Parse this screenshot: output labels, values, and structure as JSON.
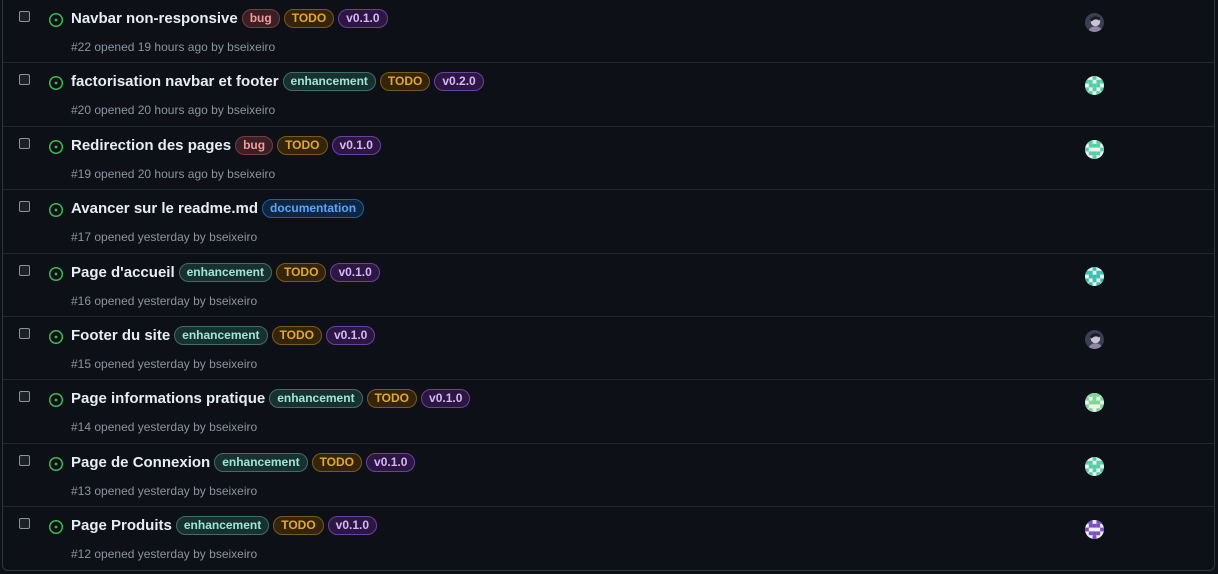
{
  "issues": [
    {
      "title": "Navbar non-responsive",
      "number": "#22",
      "opened": "opened 19 hours ago by",
      "author": "bseixeiro",
      "labels": [
        {
          "text": "bug",
          "kind": "bug"
        },
        {
          "text": "TODO",
          "kind": "todo"
        },
        {
          "text": "v0.1.0",
          "kind": "version"
        }
      ],
      "avatar": "photo"
    },
    {
      "title": "factorisation navbar et footer",
      "number": "#20",
      "opened": "opened 20 hours ago by",
      "author": "bseixeiro",
      "labels": [
        {
          "text": "enhancement",
          "kind": "enhancement"
        },
        {
          "text": "TODO",
          "kind": "todo"
        },
        {
          "text": "v0.2.0",
          "kind": "version"
        }
      ],
      "avatar": "mint"
    },
    {
      "title": "Redirection des pages",
      "number": "#19",
      "opened": "opened 20 hours ago by",
      "author": "bseixeiro",
      "labels": [
        {
          "text": "bug",
          "kind": "bug"
        },
        {
          "text": "TODO",
          "kind": "todo"
        },
        {
          "text": "v0.1.0",
          "kind": "version"
        }
      ],
      "avatar": "mint"
    },
    {
      "title": "Avancer sur le readme.md",
      "number": "#17",
      "opened": "opened yesterday by",
      "author": "bseixeiro",
      "labels": [
        {
          "text": "documentation",
          "kind": "documentation"
        }
      ],
      "avatar": ""
    },
    {
      "title": "Page d'accueil",
      "number": "#16",
      "opened": "opened yesterday by",
      "author": "bseixeiro",
      "labels": [
        {
          "text": "enhancement",
          "kind": "enhancement"
        },
        {
          "text": "TODO",
          "kind": "todo"
        },
        {
          "text": "v0.1.0",
          "kind": "version"
        }
      ],
      "avatar": "teal"
    },
    {
      "title": "Footer du site",
      "number": "#15",
      "opened": "opened yesterday by",
      "author": "bseixeiro",
      "labels": [
        {
          "text": "enhancement",
          "kind": "enhancement"
        },
        {
          "text": "TODO",
          "kind": "todo"
        },
        {
          "text": "v0.1.0",
          "kind": "version"
        }
      ],
      "avatar": "photo"
    },
    {
      "title": "Page informations pratique",
      "number": "#14",
      "opened": "opened yesterday by",
      "author": "bseixeiro",
      "labels": [
        {
          "text": "enhancement",
          "kind": "enhancement"
        },
        {
          "text": "TODO",
          "kind": "todo"
        },
        {
          "text": "v0.1.0",
          "kind": "version"
        }
      ],
      "avatar": "green"
    },
    {
      "title": "Page de Connexion",
      "number": "#13",
      "opened": "opened yesterday by",
      "author": "bseixeiro",
      "labels": [
        {
          "text": "enhancement",
          "kind": "enhancement"
        },
        {
          "text": "TODO",
          "kind": "todo"
        },
        {
          "text": "v0.1.0",
          "kind": "version"
        }
      ],
      "avatar": "mint"
    },
    {
      "title": "Page Produits",
      "number": "#12",
      "opened": "opened yesterday by",
      "author": "bseixeiro",
      "labels": [
        {
          "text": "enhancement",
          "kind": "enhancement"
        },
        {
          "text": "TODO",
          "kind": "todo"
        },
        {
          "text": "v0.1.0",
          "kind": "version"
        }
      ],
      "avatar": "purple"
    }
  ],
  "colors": {
    "open_icon": "#3fb950",
    "background": "#0d1117",
    "avatar_mint": "#4fd1a5",
    "avatar_teal": "#35c2b0",
    "avatar_green": "#7bd88f",
    "avatar_purple": "#7b4fc4"
  }
}
